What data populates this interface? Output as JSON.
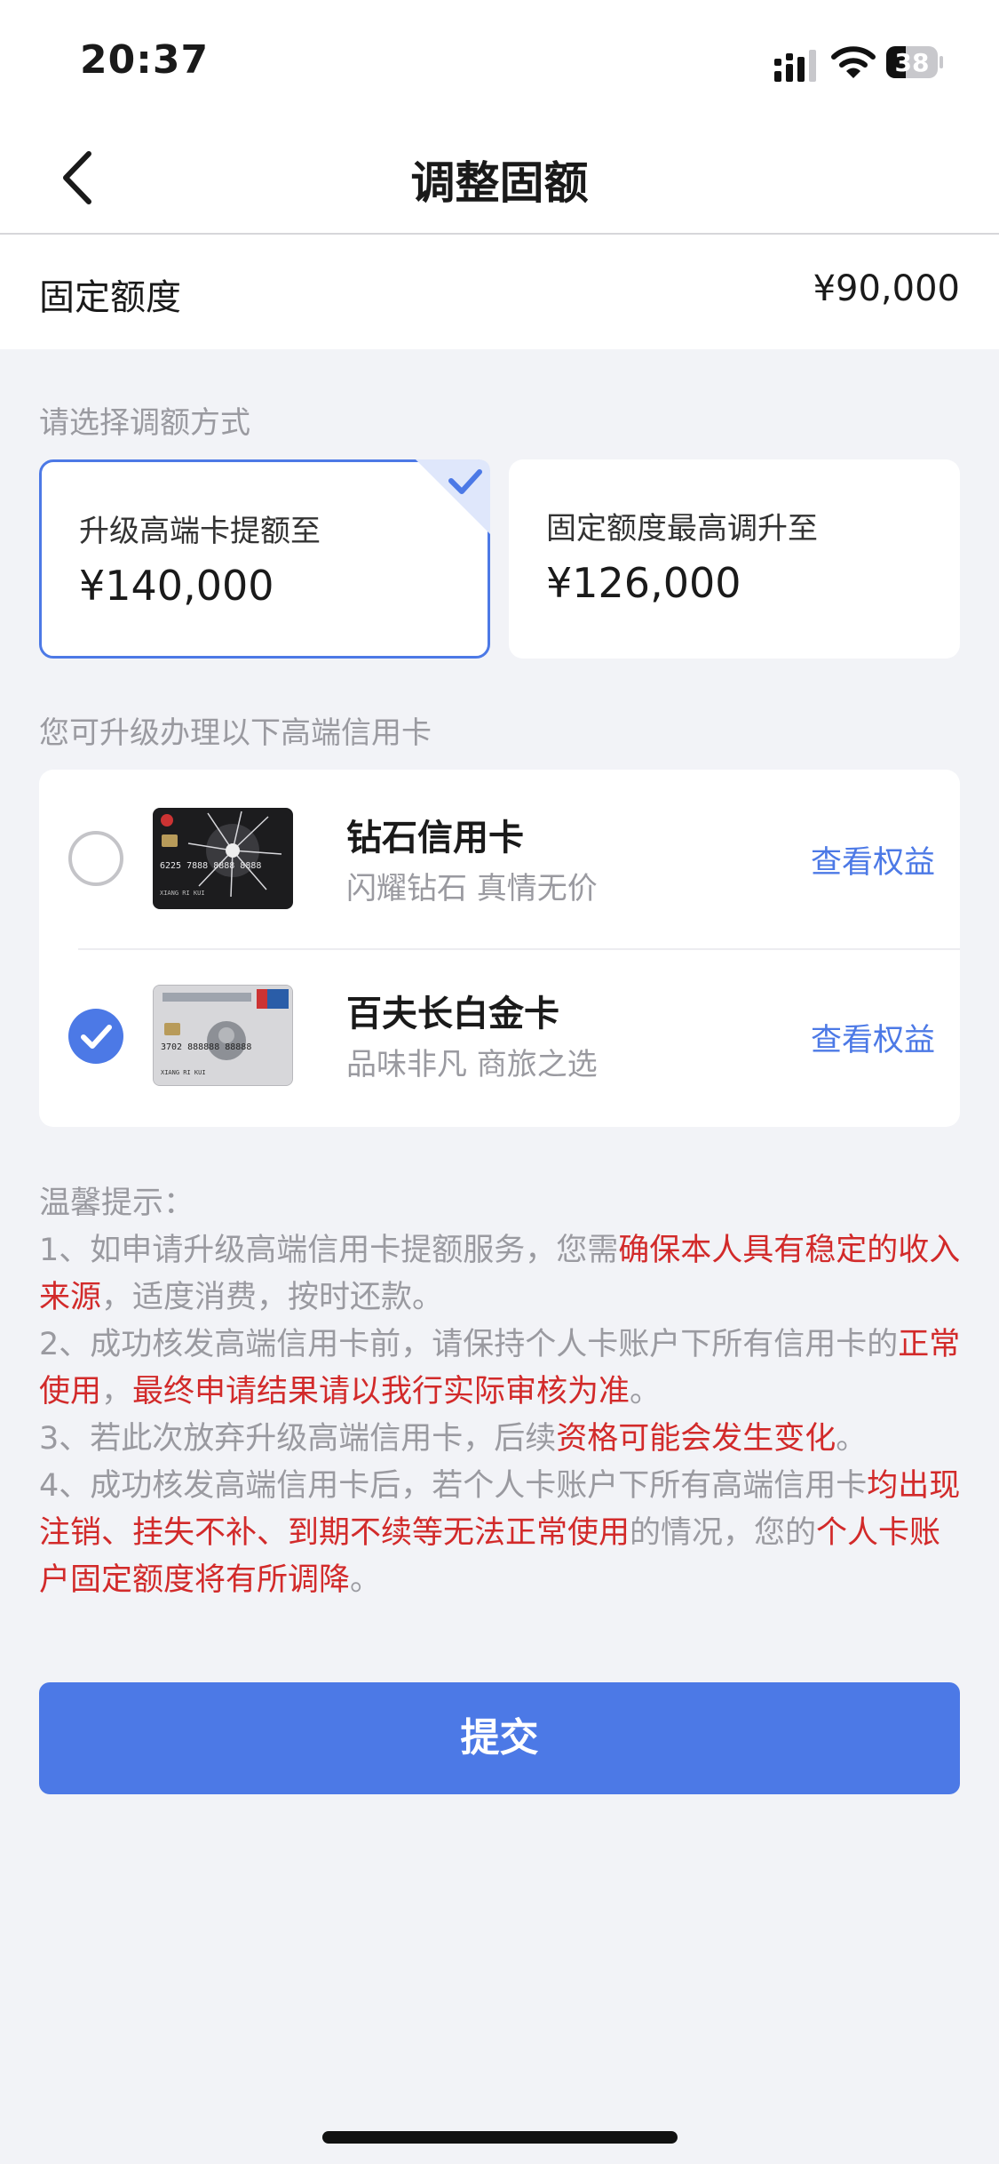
{
  "status_bar": {
    "time": "20:37",
    "battery": "38"
  },
  "nav": {
    "title": "调整固额"
  },
  "fixed_limit": {
    "label": "固定额度",
    "value": "¥90,000"
  },
  "method": {
    "section_label": "请选择调额方式",
    "options": [
      {
        "title": "升级高端卡提额至",
        "amount": "¥140,000",
        "selected": true
      },
      {
        "title": "固定额度最高调升至",
        "amount": "¥126,000",
        "selected": false
      }
    ]
  },
  "cards": {
    "section_label": "您可升级办理以下高端信用卡",
    "items": [
      {
        "name": "钻石信用卡",
        "desc": "闪耀钻石 真情无价",
        "link": "查看权益",
        "selected": false,
        "card_text": "6225 7888 8888 8888",
        "holder": "XIANG RI KUI"
      },
      {
        "name": "百夫长白金卡",
        "desc": "品味非凡 商旅之选",
        "link": "查看权益",
        "selected": true,
        "card_text": "3702 888888 88888",
        "holder": "XIANG RI KUI"
      }
    ]
  },
  "notes": {
    "title": "温馨提示：",
    "n1_a": "1、如申请升级高端信用卡提额服务，您需",
    "n1_b": "确保本人具有稳定的收入来源",
    "n1_c": "，适度消费，按时还款。",
    "n2_a": "2、成功核发高端信用卡前，请保持个人卡账户下所有信用卡的",
    "n2_b": "正常使用",
    "n2_c": "，",
    "n2_d": "最终申请结果请以我行实际审核为准",
    "n2_e": "。",
    "n3_a": "3、若此次放弃升级高端信用卡，后续",
    "n3_b": "资格可能会发生变化",
    "n3_c": "。",
    "n4_a": "4、成功核发高端信用卡后，若个人卡账户下所有高端信用卡",
    "n4_b": "均出现注销、挂失不补、到期不续等无法正常使用",
    "n4_c": "的情况，您的",
    "n4_d": "个人卡账户固定额度将有所调降",
    "n4_e": "。"
  },
  "submit": {
    "label": "提交"
  },
  "colors": {
    "accent": "#4c79e6",
    "warning": "#d22a2a",
    "muted": "#9a9aa0"
  }
}
